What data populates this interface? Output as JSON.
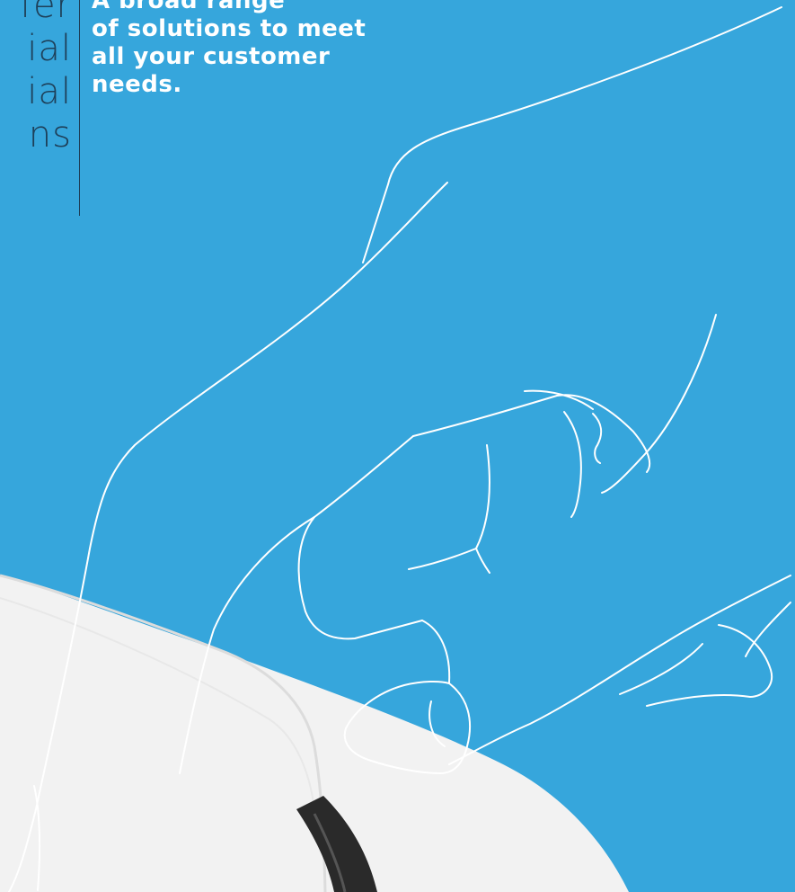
{
  "headline_left": {
    "lines": [
      "fer",
      "ial",
      "ial",
      "ns"
    ]
  },
  "headline_right": {
    "lines": [
      "A broad range",
      "of solutions to meet",
      "all your customer",
      "needs."
    ]
  },
  "colors": {
    "background": "#36a6dc",
    "left_text": "#1e3f58",
    "right_text": "#ffffff",
    "line_art": "#ffffff",
    "device_surface": "#f2f2f2"
  },
  "icons": [
    "hand-line-art",
    "terminal-device"
  ]
}
